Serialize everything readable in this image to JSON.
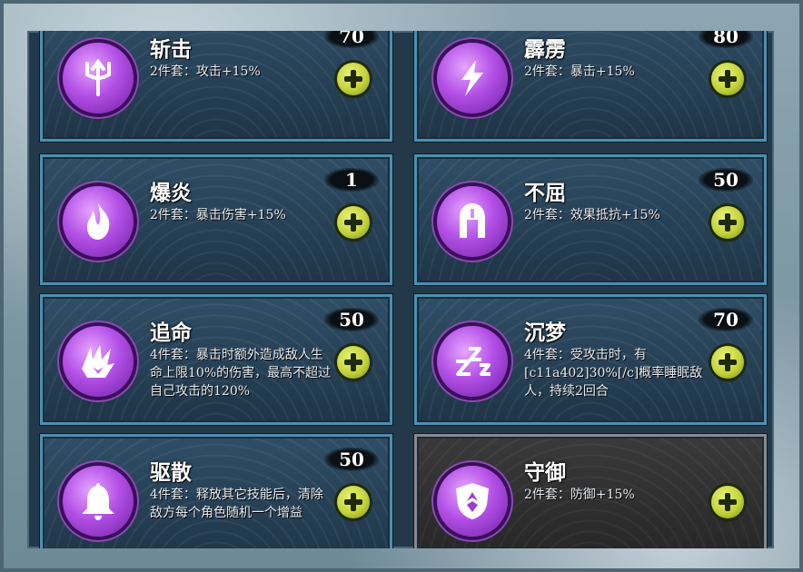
{
  "sets": [
    {
      "name": "斩击",
      "count": "70",
      "desc": "2件套：攻击+15%",
      "icon": "trident-icon"
    },
    {
      "name": "霹雳",
      "count": "80",
      "desc": "2件套：暴击+15%",
      "icon": "lightning-icon"
    },
    {
      "name": "爆炎",
      "count": "1",
      "desc": "2件套：暴击伤害+15%",
      "icon": "flame-icon"
    },
    {
      "name": "不屈",
      "count": "50",
      "desc": "2件套：效果抵抗+15%",
      "icon": "helmet-icon"
    },
    {
      "name": "追命",
      "count": "50",
      "desc": "4件套：暴击时额外造成敌人生命上限10%的伤害，最高不超过自己攻击的120%",
      "icon": "claw-icon"
    },
    {
      "name": "沉梦",
      "count": "70",
      "desc": "4件套：受攻击时，有[c11a402]30%[/c]概率睡眠敌人，持续2回合",
      "icon": "sleep-icon"
    },
    {
      "name": "驱散",
      "count": "50",
      "desc": "4件套：释放其它技能后，清除敌方每个角色随机一个增益",
      "icon": "bell-icon"
    },
    {
      "name": "守御",
      "count": "",
      "desc": "2件套：防御+15%",
      "icon": "shield-icon"
    }
  ],
  "colors": {
    "emblem": "#b350e6",
    "plus": "#c3d33a",
    "card_border": "#4d8fb0"
  }
}
